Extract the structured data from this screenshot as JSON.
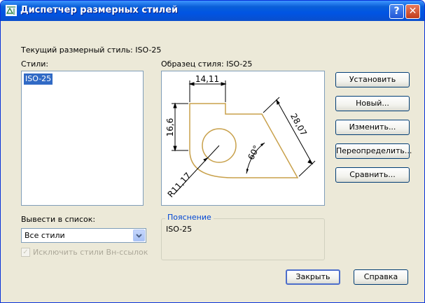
{
  "window": {
    "title": "Диспетчер размерных стилей",
    "help_glyph": "?",
    "close_glyph": "✕"
  },
  "current_style_label": "Текущий размерный стиль: ISO-25",
  "styles": {
    "label": "Стили:",
    "items": [
      "ISO-25"
    ]
  },
  "preview": {
    "label": "Образец стиля: ISO-25",
    "dims": {
      "top": "14,11",
      "left": "16,6",
      "angle": "60°",
      "diagonal": "28,07",
      "radius": "R11,17"
    }
  },
  "list_filter": {
    "label": "Вывести в список:",
    "selected": "Все стили"
  },
  "exclude_xref": {
    "label": "Исключить стили Вн-ссылок",
    "checked": true
  },
  "description": {
    "legend": "Пояснение",
    "value": "ISO-25"
  },
  "buttons": {
    "set_current": "Установить",
    "new": "Новый...",
    "modify": "Изменить...",
    "override": "Переопределить...",
    "compare": "Сравнить...",
    "close": "Закрыть",
    "help": "Справка"
  },
  "colors": {
    "titlebar": "#0054e3",
    "selection": "#316ac5",
    "geometry": "#c8a04a",
    "group_legend": "#0046d5"
  }
}
